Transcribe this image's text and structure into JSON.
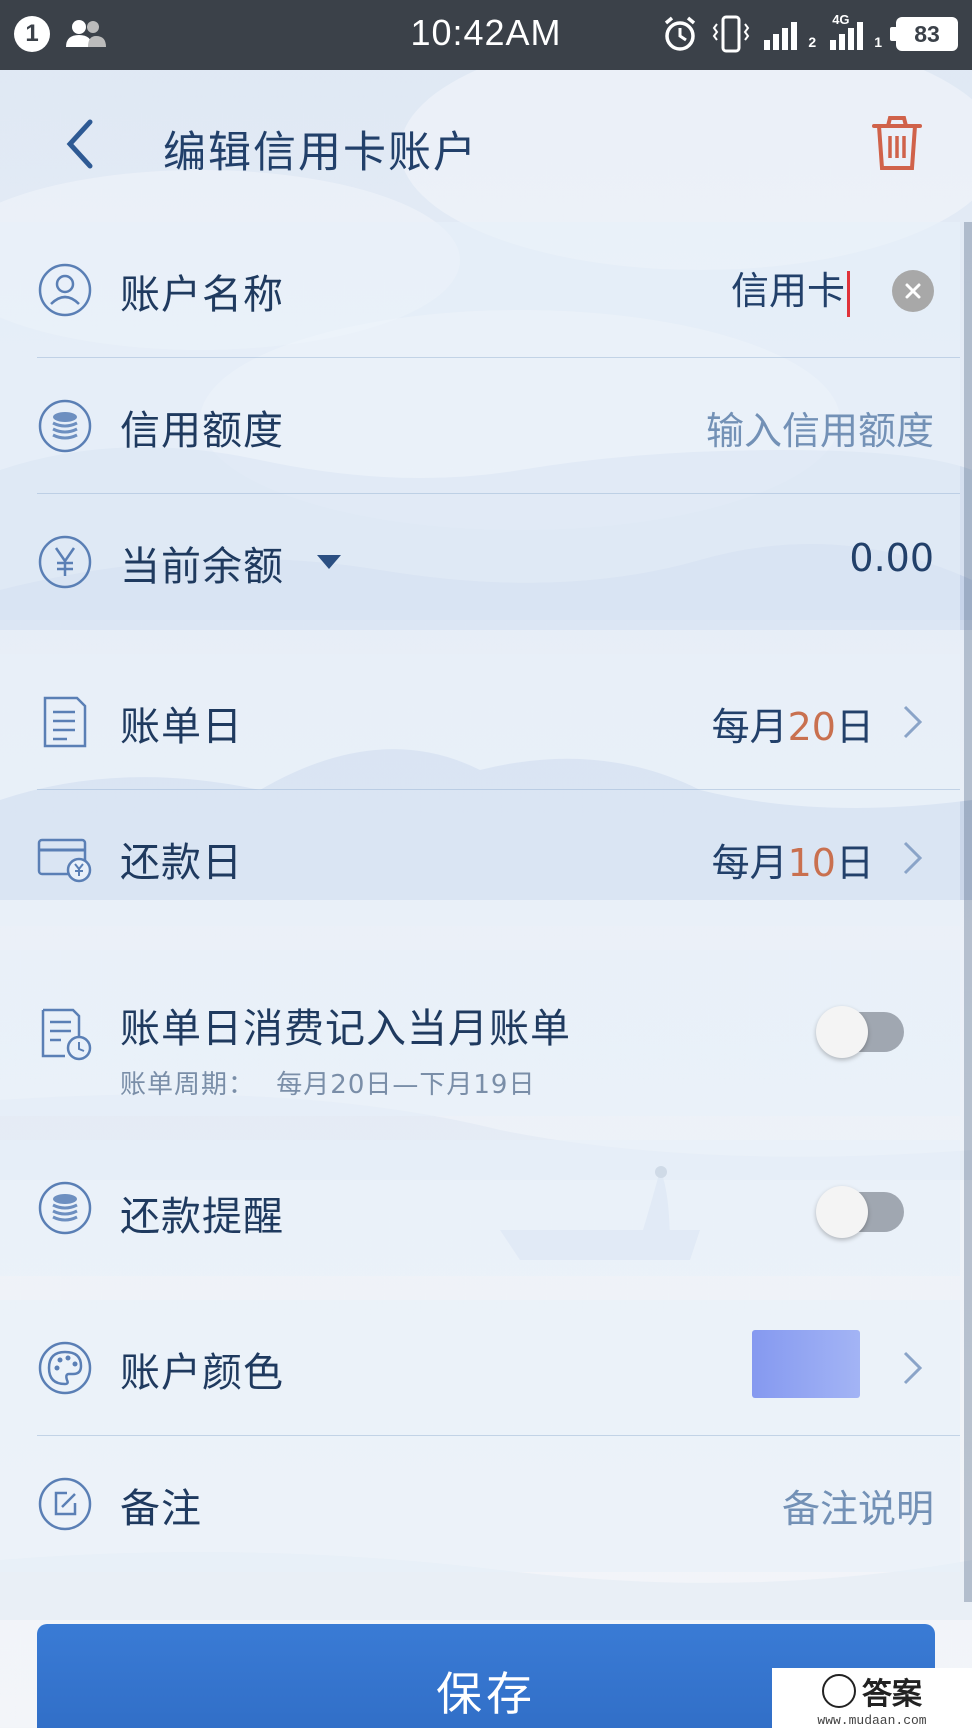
{
  "status_bar": {
    "notification_count": "1",
    "time": "10:42AM",
    "sim1": "2",
    "network": "4G",
    "sim2": "1",
    "battery": "83"
  },
  "header": {
    "title": "编辑信用卡账户",
    "back_icon": "chevron-left-icon",
    "delete_icon": "trash-icon",
    "delete_color": "#d0624a"
  },
  "fields": {
    "account_name": {
      "label": "账户名称",
      "value": "信用卡"
    },
    "credit_limit": {
      "label": "信用额度",
      "placeholder": "输入信用额度"
    },
    "current_balance": {
      "label": "当前余额",
      "value": "0.00"
    },
    "bill_day": {
      "label": "账单日",
      "prefix": "每月",
      "day": "20",
      "suffix": "日"
    },
    "repay_day": {
      "label": "还款日",
      "prefix": "每月",
      "day": "10",
      "suffix": "日"
    },
    "bill_day_consumption": {
      "label": "账单日消费记入当月账单",
      "cycle_label": "账单周期：",
      "cycle_value": "每月20日—下月19日",
      "enabled": false
    },
    "repay_reminder": {
      "label": "还款提醒",
      "enabled": false
    },
    "account_color": {
      "label": "账户颜色",
      "color": "#8fa2f2"
    },
    "note": {
      "label": "备注",
      "placeholder": "备注说明"
    }
  },
  "save_button": {
    "label": "保存"
  },
  "accent_color": "#2f6cc4",
  "highlight_color": "#c9704f",
  "watermark": {
    "text": "答案",
    "site": "www.mudaan.com"
  }
}
